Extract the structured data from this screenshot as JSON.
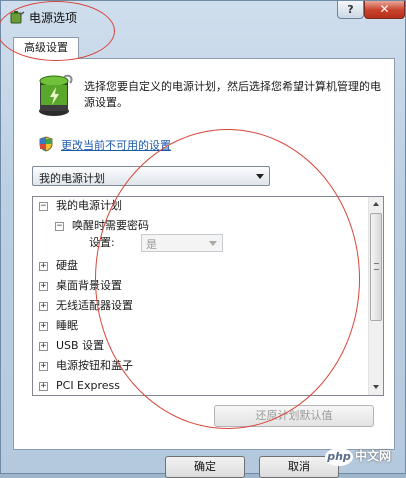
{
  "window": {
    "title": "电源选项"
  },
  "titlebar": {
    "help_label": "?",
    "close_label": "✕"
  },
  "tabs": [
    {
      "label": "高级设置"
    }
  ],
  "panel": {
    "description": "选择您要自定义的电源计划，然后选择您希望计算机管理的电源设置。",
    "link_text": "更改当前不可用的设置",
    "plan_select": {
      "value": "我的电源计划"
    }
  },
  "tree": {
    "items": [
      {
        "label": "我的电源计划",
        "state": "expanded"
      },
      {
        "label": "唤醒时需要密码",
        "state": "expanded"
      },
      {
        "label": "硬盘",
        "state": "collapsed"
      },
      {
        "label": "桌面背景设置",
        "state": "collapsed"
      },
      {
        "label": "无线适配器设置",
        "state": "collapsed"
      },
      {
        "label": "睡眠",
        "state": "collapsed"
      },
      {
        "label": "USB 设置",
        "state": "collapsed"
      },
      {
        "label": "电源按钮和盖子",
        "state": "collapsed"
      },
      {
        "label": "PCI Express",
        "state": "collapsed"
      }
    ],
    "setting": {
      "label": "设置:",
      "value": "是"
    }
  },
  "buttons": {
    "restore_label": "还原计划默认值",
    "ok_label": "确定",
    "cancel_label": "取消"
  },
  "watermark": {
    "text": "php 中文网"
  },
  "colors": {
    "link": "#1d5aab",
    "annotation": "#d8453a",
    "close": "#c7402a"
  }
}
